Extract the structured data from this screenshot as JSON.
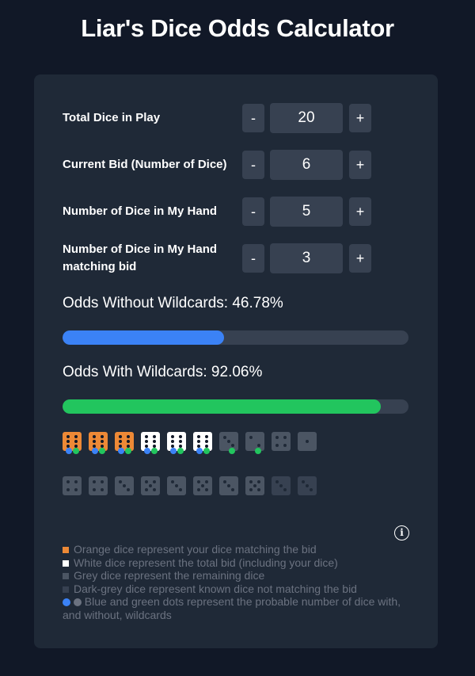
{
  "title": "Liar's Dice Odds Calculator",
  "controls": [
    {
      "label": "Total Dice in Play",
      "value": "20",
      "minus": "-",
      "plus": "+"
    },
    {
      "label": "Current Bid (Number of Dice)",
      "value": "6",
      "minus": "-",
      "plus": "+"
    },
    {
      "label": "Number of Dice in My Hand",
      "value": "5",
      "minus": "-",
      "plus": "+"
    },
    {
      "label": "Number of Dice in My Hand matching bid",
      "value": "3",
      "minus": "-",
      "plus": "+"
    }
  ],
  "odds": {
    "without_label": "Odds Without Wildcards: 46.78%",
    "without_value": 0.4678,
    "without_color": "#3b82f6",
    "with_label": "Odds With Wildcards: 92.06%",
    "with_value": 0.9206,
    "with_color": "#22c55e"
  },
  "dice_rows": [
    [
      {
        "type": "orange",
        "face": 6,
        "dots": [
          "blue",
          "green"
        ]
      },
      {
        "type": "orange",
        "face": 6,
        "dots": [
          "blue",
          "green"
        ]
      },
      {
        "type": "orange",
        "face": 6,
        "dots": [
          "blue",
          "green"
        ]
      },
      {
        "type": "white",
        "face": 6,
        "dots": [
          "blue",
          "green"
        ]
      },
      {
        "type": "white",
        "face": 6,
        "dots": [
          "blue",
          "green"
        ]
      },
      {
        "type": "white",
        "face": 6,
        "dots": [
          "blue",
          "green"
        ]
      },
      {
        "type": "grey",
        "face": 3,
        "dots": [
          "green"
        ]
      },
      {
        "type": "grey",
        "face": 2,
        "dots": [
          "green"
        ]
      },
      {
        "type": "grey",
        "face": 4,
        "dots": []
      },
      {
        "type": "grey",
        "face": 1,
        "dots": []
      }
    ],
    [
      {
        "type": "grey",
        "face": 4,
        "dots": []
      },
      {
        "type": "grey",
        "face": 4,
        "dots": []
      },
      {
        "type": "grey",
        "face": 3,
        "dots": []
      },
      {
        "type": "grey",
        "face": 5,
        "dots": []
      },
      {
        "type": "grey",
        "face": 3,
        "dots": []
      },
      {
        "type": "grey",
        "face": 5,
        "dots": []
      },
      {
        "type": "grey",
        "face": 3,
        "dots": []
      },
      {
        "type": "grey",
        "face": 5,
        "dots": []
      },
      {
        "type": "darkgrey",
        "face": 3,
        "dots": []
      },
      {
        "type": "darkgrey",
        "face": 3,
        "dots": []
      }
    ]
  ],
  "info_icon": "info-icon",
  "legend": {
    "orange": "Orange dice represent your dice matching the bid",
    "white": "White dice represent the total bid (including your dice)",
    "grey": "Grey dice represent the remaining dice",
    "darkgrey": "Dark-grey dice represent known dice not matching the bid",
    "dots": "Blue and green dots represent the probable number of dice with, and without, wildcards"
  },
  "colors": {
    "orange": "#ed8936",
    "white": "#ffffff",
    "grey": "#4b5563",
    "darkgrey": "#374151",
    "blue": "#3b82f6",
    "green": "#22c55e"
  }
}
